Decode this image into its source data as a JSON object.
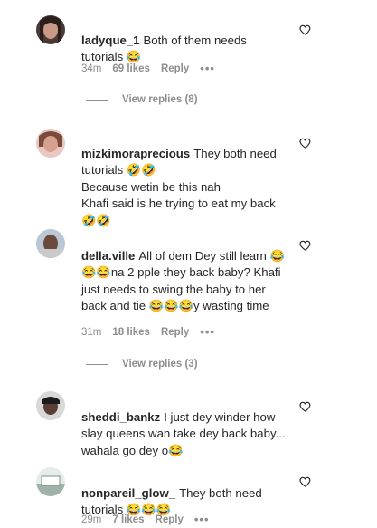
{
  "comments": [
    {
      "username": "ladyque_1",
      "text": "Both of them needs tutorials 😂",
      "time": "34m",
      "likes": "69 likes",
      "reply": "Reply",
      "more": "•••",
      "view_replies": "View replies (8)"
    },
    {
      "username": "mizkimoraprecious",
      "text": "They both need tutorials 🤣🤣\nBecause wetin be this nah\nKhafi said is he trying to eat my back🤣🤣",
      "time": "",
      "likes": "",
      "reply": "",
      "more": "",
      "view_replies": ""
    },
    {
      "username": "della.ville",
      "text": "All of dem Dey still learn 😂😂😂na 2 pple they back baby? Khafi just needs to swing the baby to her back and tie 😂😂😂y wasting time",
      "time": "31m",
      "likes": "18 likes",
      "reply": "Reply",
      "more": "•••",
      "view_replies": "View replies (3)"
    },
    {
      "username": "sheddi_bankz",
      "text": "I just dey winder how slay queens wan take dey back baby... wahala go dey o😂",
      "time": "",
      "likes": "",
      "reply": "",
      "more": "",
      "view_replies": ""
    },
    {
      "username": "nonpareil_glow_",
      "text": "They both need tutorials 😂😂😂",
      "time": "29m",
      "likes": "7 likes",
      "reply": "Reply",
      "more": "•••",
      "view_replies": ""
    }
  ]
}
